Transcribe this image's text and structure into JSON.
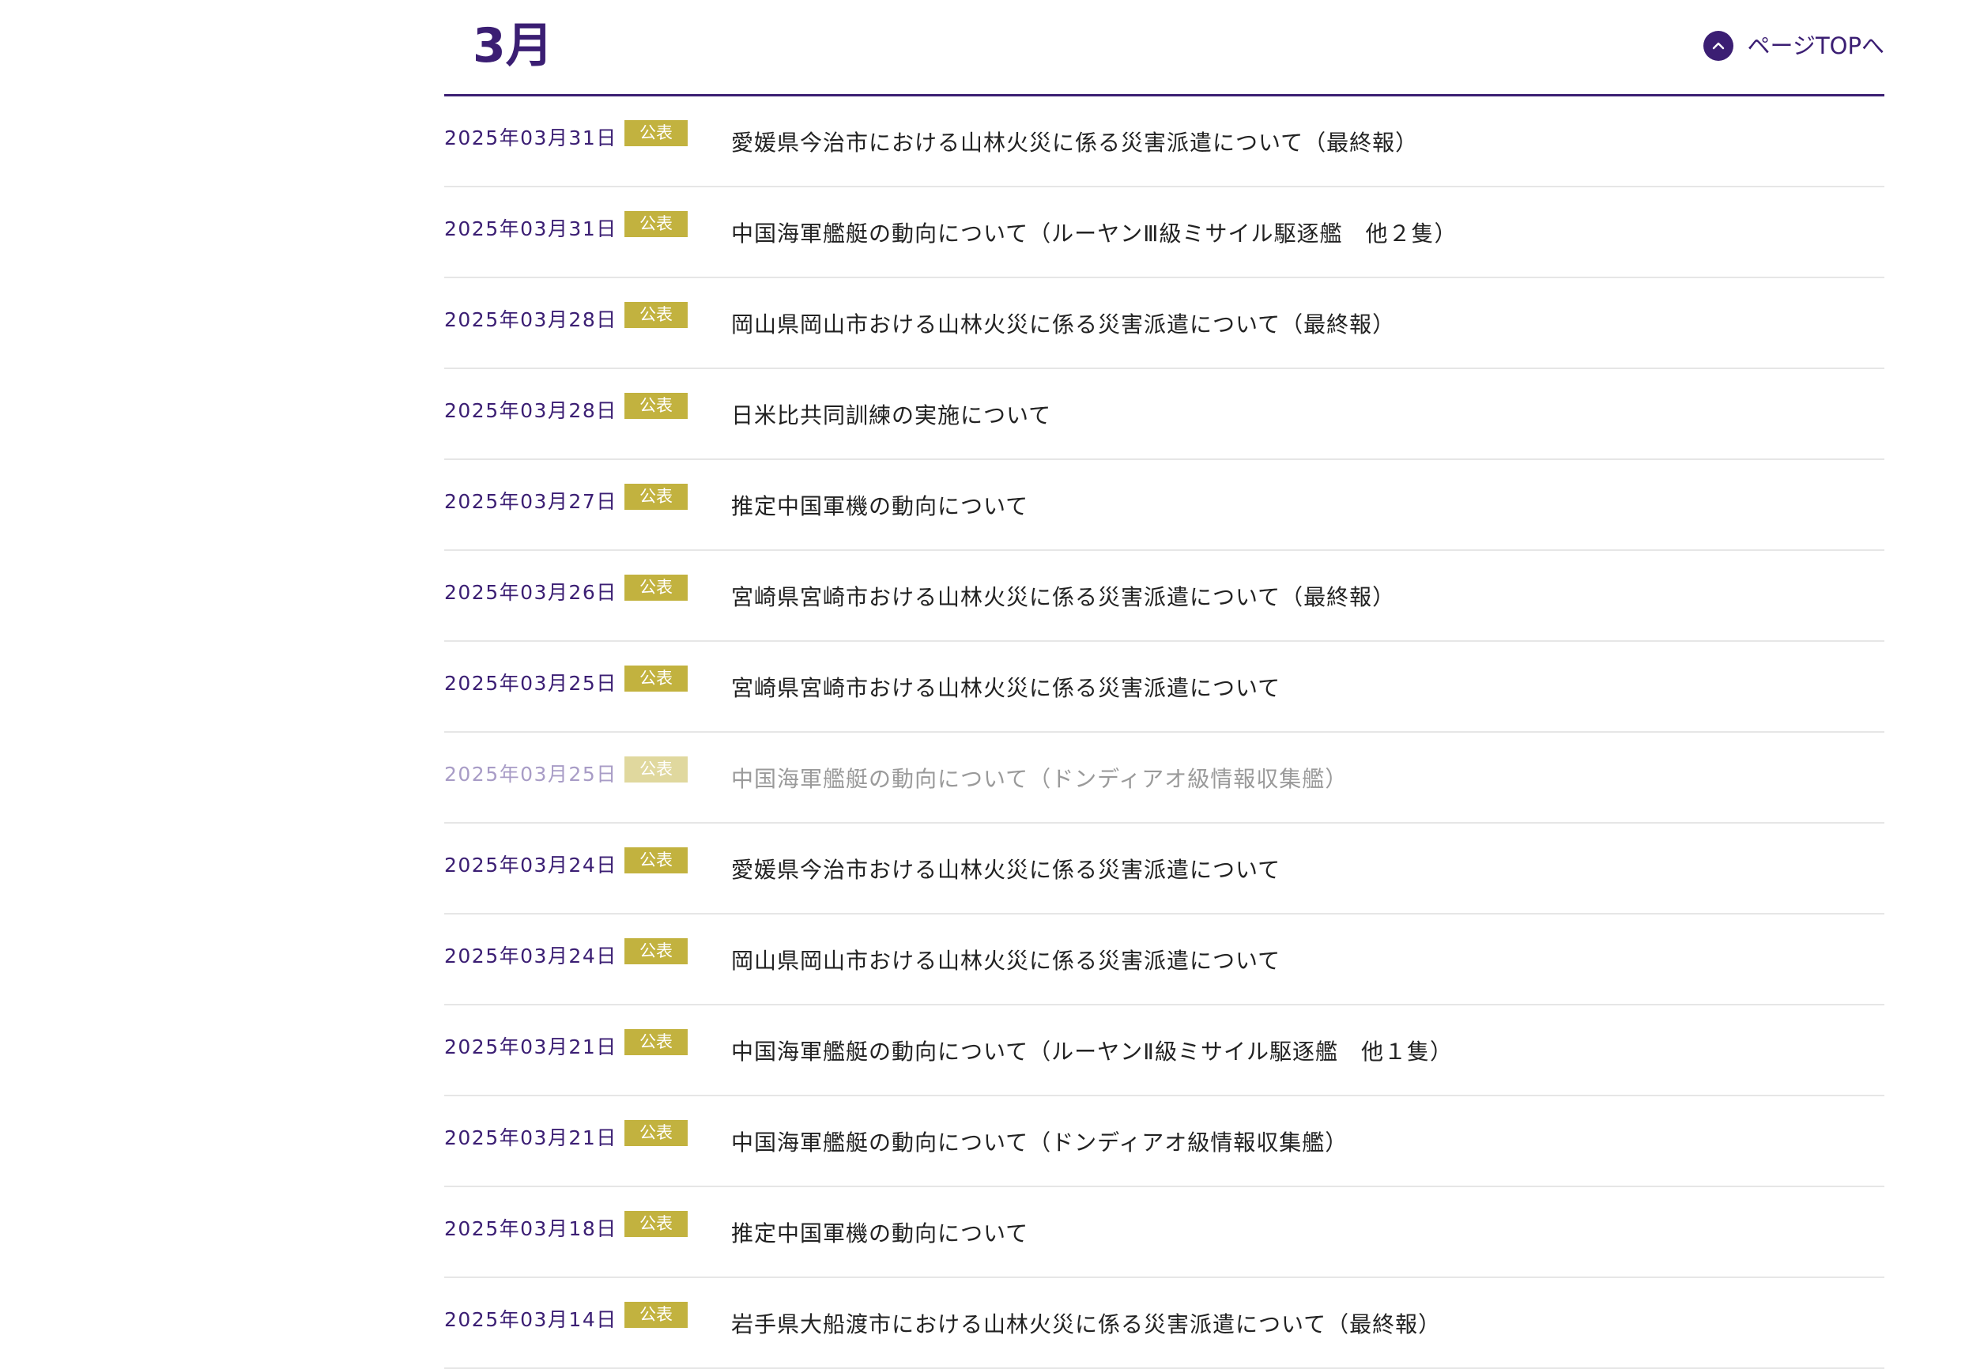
{
  "month_section": {
    "title": "3月",
    "page_top_label": "ページTOPへ"
  },
  "news": [
    {
      "date": "2025年03月31日",
      "badge": "公表",
      "title": "愛媛県今治市における山林火災に係る災害派遣について（最終報）"
    },
    {
      "date": "2025年03月31日",
      "badge": "公表",
      "title": "中国海軍艦艇の動向について（ルーヤンⅢ級ミサイル駆逐艦　他２隻）"
    },
    {
      "date": "2025年03月28日",
      "badge": "公表",
      "title": "岡山県岡山市おける山林火災に係る災害派遣について（最終報）"
    },
    {
      "date": "2025年03月28日",
      "badge": "公表",
      "title": "日米比共同訓練の実施について"
    },
    {
      "date": "2025年03月27日",
      "badge": "公表",
      "title": "推定中国軍機の動向について"
    },
    {
      "date": "2025年03月26日",
      "badge": "公表",
      "title": "宮崎県宮崎市おける山林火災に係る災害派遣について（最終報）"
    },
    {
      "date": "2025年03月25日",
      "badge": "公表",
      "title": "宮崎県宮崎市おける山林火災に係る災害派遣について"
    },
    {
      "date": "2025年03月25日",
      "badge": "公表",
      "title": "中国海軍艦艇の動向について（ドンディアオ級情報収集艦）"
    },
    {
      "date": "2025年03月24日",
      "badge": "公表",
      "title": "愛媛県今治市おける山林火災に係る災害派遣について"
    },
    {
      "date": "2025年03月24日",
      "badge": "公表",
      "title": "岡山県岡山市おける山林火災に係る災害派遣について"
    },
    {
      "date": "2025年03月21日",
      "badge": "公表",
      "title": "中国海軍艦艇の動向について（ルーヤンⅡ級ミサイル駆逐艦　他１隻）"
    },
    {
      "date": "2025年03月21日",
      "badge": "公表",
      "title": "中国海軍艦艇の動向について（ドンディアオ級情報収集艦）"
    },
    {
      "date": "2025年03月18日",
      "badge": "公表",
      "title": "推定中国軍機の動向について"
    },
    {
      "date": "2025年03月14日",
      "badge": "公表",
      "title": "岩手県大船渡市における山林火災に係る災害派遣について（最終報）"
    }
  ],
  "colors": {
    "accent": "#3b1e73",
    "badge": "#c2b23f",
    "divider": "#e6e6e6"
  },
  "icons": {
    "page_top": "chevron-up-icon"
  }
}
